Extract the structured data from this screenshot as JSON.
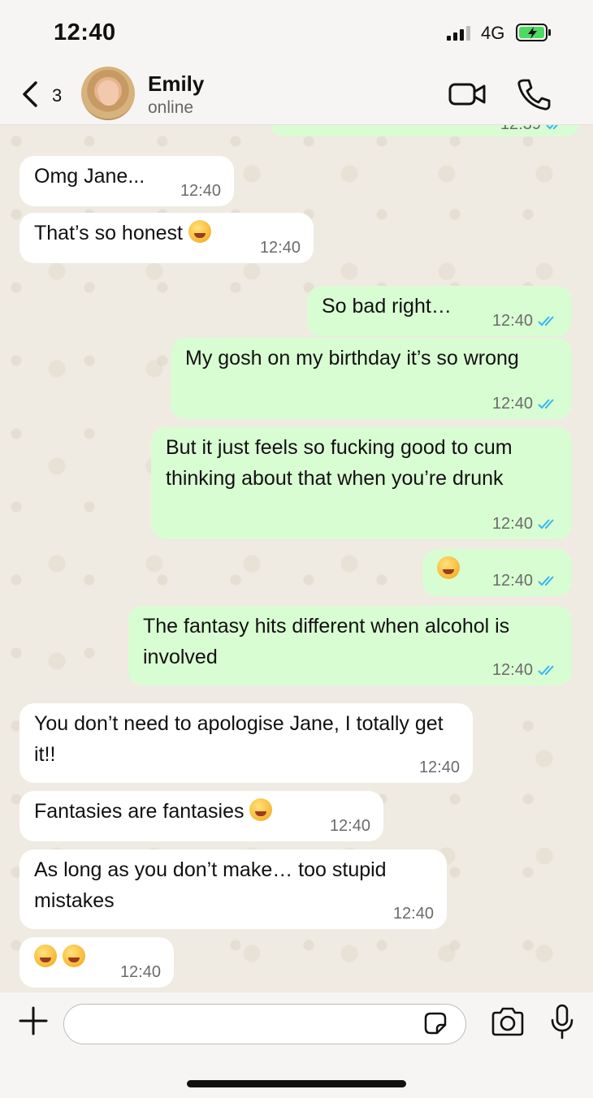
{
  "status_bar": {
    "time": "12:40",
    "network": "4G"
  },
  "header": {
    "back_count": "3",
    "contact_name": "Emily",
    "contact_status": "online",
    "icons": {
      "back": "chevron-left-icon",
      "video": "video-camera-icon",
      "call": "phone-icon"
    }
  },
  "chat": {
    "previous_time": "12:39",
    "messages": [
      {
        "dir": "in",
        "text": "Omg Jane...",
        "time": "12:40"
      },
      {
        "dir": "in",
        "text": "That’s so honest",
        "emoji": "grinning-sweat-emoji",
        "time": "12:40"
      },
      {
        "dir": "out",
        "text": "So bad right…",
        "time": "12:40",
        "read": true
      },
      {
        "dir": "out",
        "text": "My gosh on my birthday it’s so wrong",
        "time": "12:40",
        "read": true
      },
      {
        "dir": "out",
        "text": "But it just feels so fucking good to cum thinking about that when you’re drunk",
        "time": "12:40",
        "read": true
      },
      {
        "dir": "out",
        "text": "",
        "emoji": "squinting-tongue-emoji",
        "time": "12:40",
        "read": true
      },
      {
        "dir": "out",
        "text": "The fantasy hits different when alcohol is involved",
        "time": "12:40",
        "read": true
      },
      {
        "dir": "in",
        "text": "You don’t need to apologise Jane, I totally get it!!",
        "time": "12:40"
      },
      {
        "dir": "in",
        "text": "Fantasies are fantasies",
        "emoji": "drooling-face-emoji",
        "time": "12:40"
      },
      {
        "dir": "in",
        "text": "As long as you don’t make… too stupid mistakes",
        "time": "12:40"
      },
      {
        "dir": "in",
        "text": "",
        "emoji": "pleading-face-emoji",
        "time": "12:40"
      }
    ]
  },
  "input_bar": {
    "placeholder": "",
    "icons": {
      "add": "plus-icon",
      "sticker": "sticker-icon",
      "camera": "camera-icon",
      "mic": "microphone-icon"
    }
  },
  "colors": {
    "incoming": "#ffffff",
    "outgoing": "#d9fdd3",
    "read_ticks": "#34b7f1",
    "chat_bg": "#efeae2"
  }
}
